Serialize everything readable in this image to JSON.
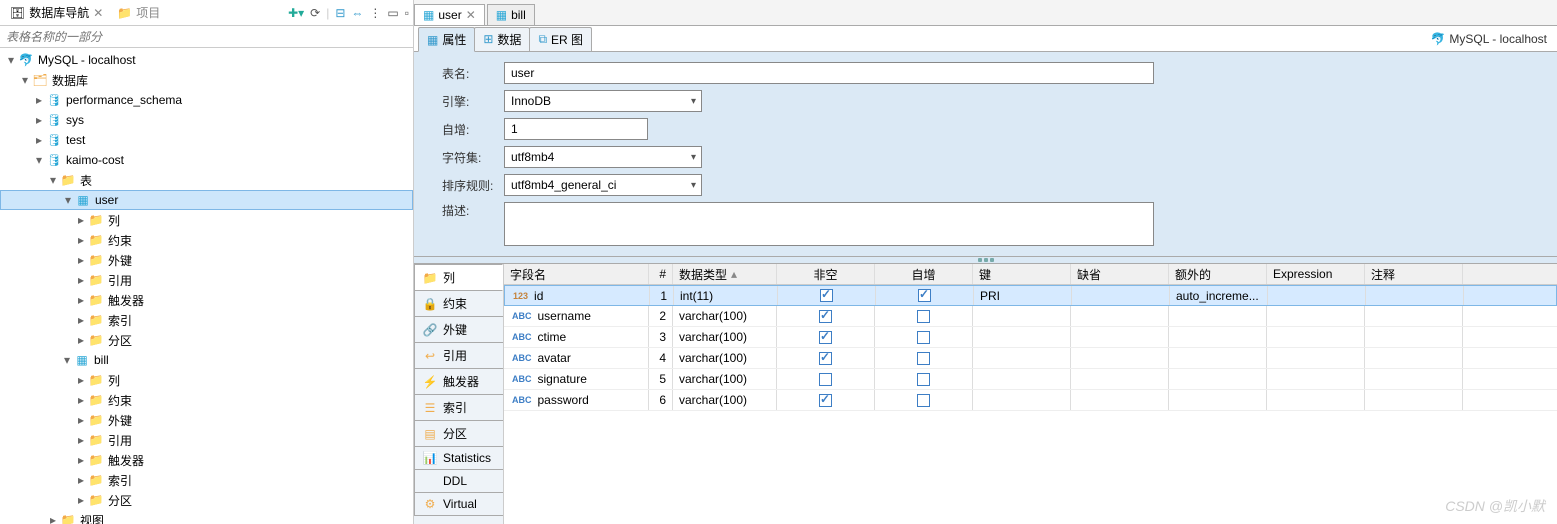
{
  "leftTabs": {
    "active": "数据库导航",
    "inactive": "项目"
  },
  "filterPlaceholder": "表格名称的一部分",
  "connectionName": "MySQL - localhost",
  "tree": {
    "connection": "MySQL - localhost",
    "dbGroup": "数据库",
    "dbs": [
      "performance_schema",
      "sys",
      "test"
    ],
    "currentDb": "kaimo-cost",
    "tablesLabel": "表",
    "tables": {
      "user": {
        "label": "user",
        "children": [
          "列",
          "约束",
          "外键",
          "引用",
          "触发器",
          "索引",
          "分区"
        ]
      },
      "bill": {
        "label": "bill",
        "children": [
          "列",
          "约束",
          "外键",
          "引用",
          "触发器",
          "索引",
          "分区"
        ]
      }
    },
    "viewsLabel": "视图"
  },
  "editorTabs": {
    "active": "user",
    "other": "bill"
  },
  "subTabs": {
    "properties": "属性",
    "data": "数据",
    "er": "ER 图"
  },
  "form": {
    "nameLabel": "表名:",
    "nameVal": "user",
    "engineLabel": "引擎:",
    "engineVal": "InnoDB",
    "autoIncLabel": "自增:",
    "autoIncVal": "1",
    "charsetLabel": "字符集:",
    "charsetVal": "utf8mb4",
    "collationLabel": "排序规则:",
    "collationVal": "utf8mb4_general_ci",
    "descLabel": "描述:",
    "descVal": ""
  },
  "sideTabs": [
    "列",
    "约束",
    "外键",
    "引用",
    "触发器",
    "索引",
    "分区",
    "Statistics",
    "DDL",
    "Virtual"
  ],
  "columnsHeader": {
    "name": "字段名",
    "num": "#",
    "type": "数据类型",
    "notNull": "非空",
    "autoInc": "自增",
    "key": "键",
    "default": "缺省",
    "extra": "额外的",
    "expr": "Expression",
    "comment": "注释"
  },
  "columns": [
    {
      "badge": "123",
      "name": "id",
      "num": "1",
      "type": "int(11)",
      "nn": true,
      "ai": true,
      "key": "PRI",
      "def": "",
      "extra": "auto_increme...",
      "sel": true
    },
    {
      "badge": "ABC",
      "name": "username",
      "num": "2",
      "type": "varchar(100)",
      "nn": true,
      "ai": false,
      "key": "",
      "def": "",
      "extra": ""
    },
    {
      "badge": "ABC",
      "name": "ctime",
      "num": "3",
      "type": "varchar(100)",
      "nn": true,
      "ai": false,
      "key": "",
      "def": "",
      "extra": ""
    },
    {
      "badge": "ABC",
      "name": "avatar",
      "num": "4",
      "type": "varchar(100)",
      "nn": true,
      "ai": false,
      "key": "",
      "def": "",
      "extra": ""
    },
    {
      "badge": "ABC",
      "name": "signature",
      "num": "5",
      "type": "varchar(100)",
      "nn": false,
      "ai": false,
      "key": "",
      "def": "",
      "extra": ""
    },
    {
      "badge": "ABC",
      "name": "password",
      "num": "6",
      "type": "varchar(100)",
      "nn": true,
      "ai": false,
      "key": "",
      "def": "",
      "extra": ""
    }
  ],
  "watermark": "CSDN @凯小默"
}
